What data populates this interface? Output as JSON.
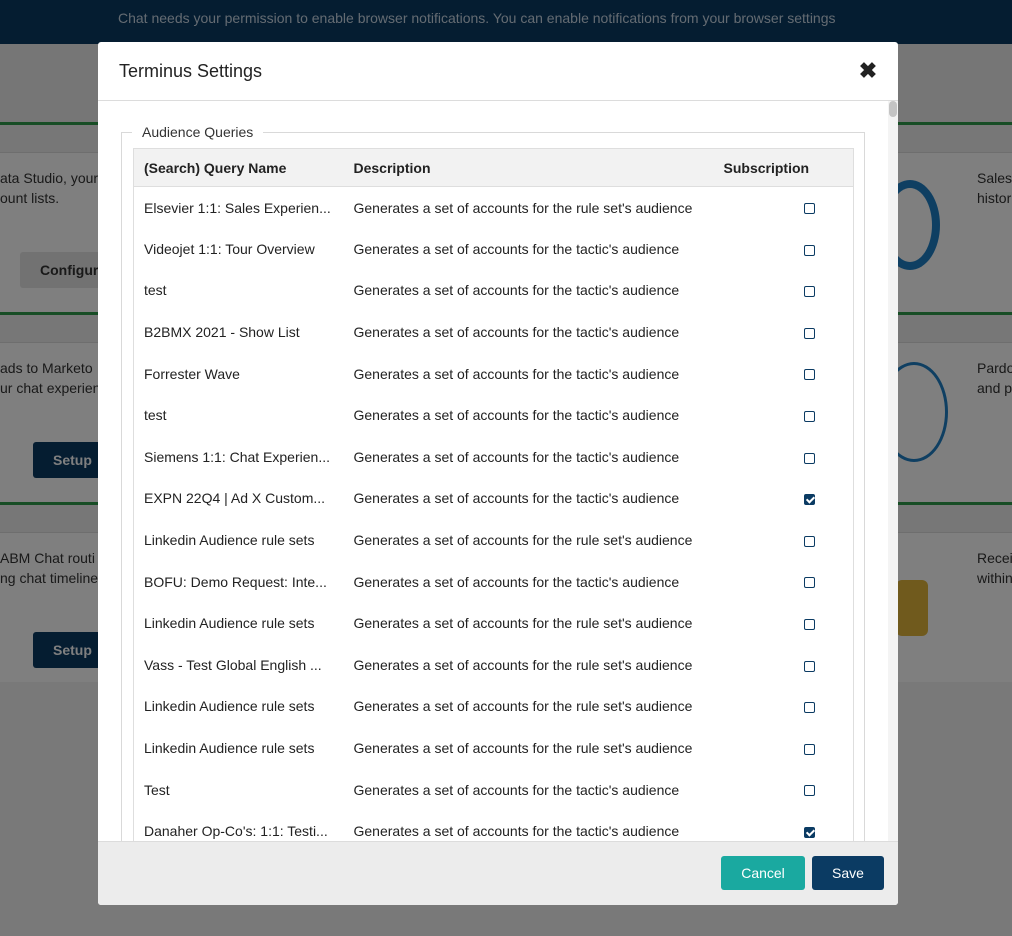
{
  "notification": "Chat needs your permission to enable browser notifications. You can enable notifications from your browser settings",
  "background": {
    "text_1a": "ata Studio, your",
    "text_1b": "ount lists.",
    "configure_label": "Configure",
    "text_2a": "ads to Marketo",
    "text_2b": "ur chat experience",
    "setup_label": "Setup",
    "text_3a": "ABM Chat routi",
    "text_3b": "ng chat timeline",
    "right_1a": "Sales",
    "right_1b": "histor",
    "right_2a": "Pardo",
    "right_2b": "and p",
    "right_3a": "Recei",
    "right_3b": "within"
  },
  "modal": {
    "title": "Terminus Settings",
    "close_glyph": "✖",
    "fieldset_legend": "Audience Queries",
    "columns": {
      "name": "(Search) Query Name",
      "description": "Description",
      "subscription": "Subscription"
    },
    "rows": [
      {
        "name": "Elsevier 1:1: Sales Experien...",
        "description": "Generates a set of accounts for the rule set's audience",
        "subscribed": false
      },
      {
        "name": "Videojet 1:1: Tour Overview",
        "description": "Generates a set of accounts for the tactic's audience",
        "subscribed": false
      },
      {
        "name": "test",
        "description": "Generates a set of accounts for the tactic's audience",
        "subscribed": false
      },
      {
        "name": "B2BMX 2021 - Show List",
        "description": "Generates a set of accounts for the tactic's audience",
        "subscribed": false
      },
      {
        "name": "Forrester Wave",
        "description": "Generates a set of accounts for the tactic's audience",
        "subscribed": false
      },
      {
        "name": "test",
        "description": "Generates a set of accounts for the tactic's audience",
        "subscribed": false
      },
      {
        "name": "Siemens 1:1: Chat Experien...",
        "description": "Generates a set of accounts for the tactic's audience",
        "subscribed": false
      },
      {
        "name": "EXPN 22Q4 | Ad X Custom...",
        "description": "Generates a set of accounts for the tactic's audience",
        "subscribed": true
      },
      {
        "name": "Linkedin Audience rule sets",
        "description": "Generates a set of accounts for the rule set's audience",
        "subscribed": false
      },
      {
        "name": "BOFU: Demo Request: Inte...",
        "description": "Generates a set of accounts for the tactic's audience",
        "subscribed": false
      },
      {
        "name": "Linkedin Audience rule sets",
        "description": "Generates a set of accounts for the rule set's audience",
        "subscribed": false
      },
      {
        "name": "Vass - Test Global English ...",
        "description": "Generates a set of accounts for the rule set's audience",
        "subscribed": false
      },
      {
        "name": "Linkedin Audience rule sets",
        "description": "Generates a set of accounts for the rule set's audience",
        "subscribed": false
      },
      {
        "name": "Linkedin Audience rule sets",
        "description": "Generates a set of accounts for the rule set's audience",
        "subscribed": false
      },
      {
        "name": "Test",
        "description": "Generates a set of accounts for the tactic's audience",
        "subscribed": false
      },
      {
        "name": "Danaher Op-Co's: 1:1: Testi...",
        "description": "Generates a set of accounts for the tactic's audience",
        "subscribed": true
      }
    ],
    "cancel_label": "Cancel",
    "save_label": "Save"
  },
  "colors": {
    "primary": "#0b3b63",
    "teal": "#1aa9a0",
    "green_accent": "#2f9a4a"
  }
}
